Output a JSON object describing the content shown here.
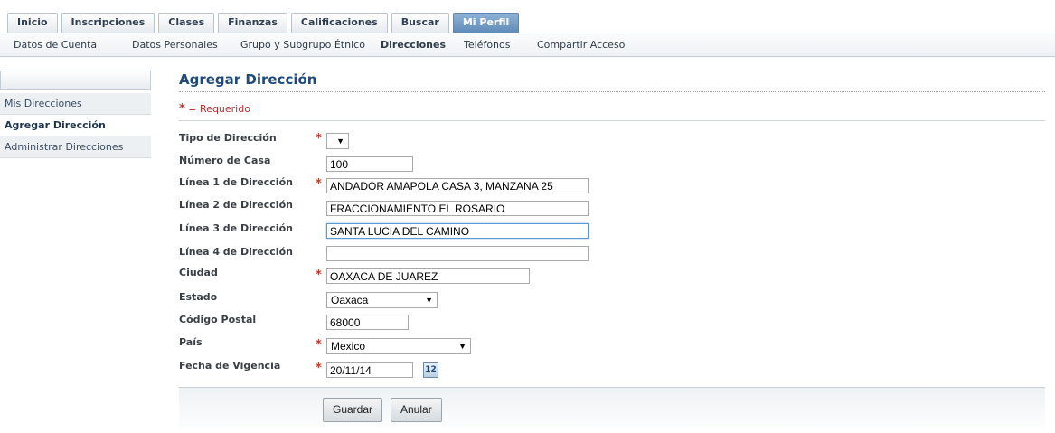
{
  "tabs": [
    "Inicio",
    "Inscripciones",
    "Clases",
    "Finanzas",
    "Calificaciones",
    "Buscar",
    "Mi Perfil"
  ],
  "active_tab": "Mi Perfil",
  "subnav": [
    "Datos de Cuenta",
    "Datos Personales",
    "Grupo y Subgrupo Étnico",
    "Direcciones",
    "Teléfonos",
    "Compartir Acceso"
  ],
  "active_subnav": "Direcciones",
  "sidebar": {
    "items": [
      "Mis Direcciones",
      "Agregar Dirección",
      "Administrar Direcciones"
    ],
    "active": "Agregar Dirección"
  },
  "page": {
    "title": "Agregar Dirección",
    "required_star": "*",
    "required_note": " = Requerido"
  },
  "form": {
    "tipo_label": "Tipo de Dirección",
    "tipo_value": "",
    "numero_label": "Número de Casa",
    "numero_value": "100",
    "linea1_label": "Línea 1 de Dirección",
    "linea1_value": "ANDADOR AMAPOLA CASA 3, MANZANA 25",
    "linea2_label": "Línea 2 de Dirección",
    "linea2_value": "FRACCIONAMIENTO EL ROSARIO",
    "linea3_label": "Línea 3 de Dirección",
    "linea3_value": "SANTA LUCIA DEL CAMINO",
    "linea4_label": "Línea 4 de Dirección",
    "linea4_value": "",
    "ciudad_label": "Ciudad",
    "ciudad_value": "OAXACA DE JUAREZ",
    "estado_label": "Estado",
    "estado_value": "Oaxaca",
    "cp_label": "Código Postal",
    "cp_value": "68000",
    "pais_label": "País",
    "pais_value": "Mexico",
    "fecha_label": "Fecha de Vigencia",
    "fecha_value": "20/11/14",
    "calendar_icon_text": "12"
  },
  "buttons": {
    "save": "Guardar",
    "cancel": "Anular"
  },
  "icons": {
    "dropdown": "chevron-down-icon",
    "calendar": "calendar-icon"
  },
  "colors": {
    "active_tab": "#6b93bf",
    "title": "#1f4a7a",
    "required": "#c0392b"
  }
}
